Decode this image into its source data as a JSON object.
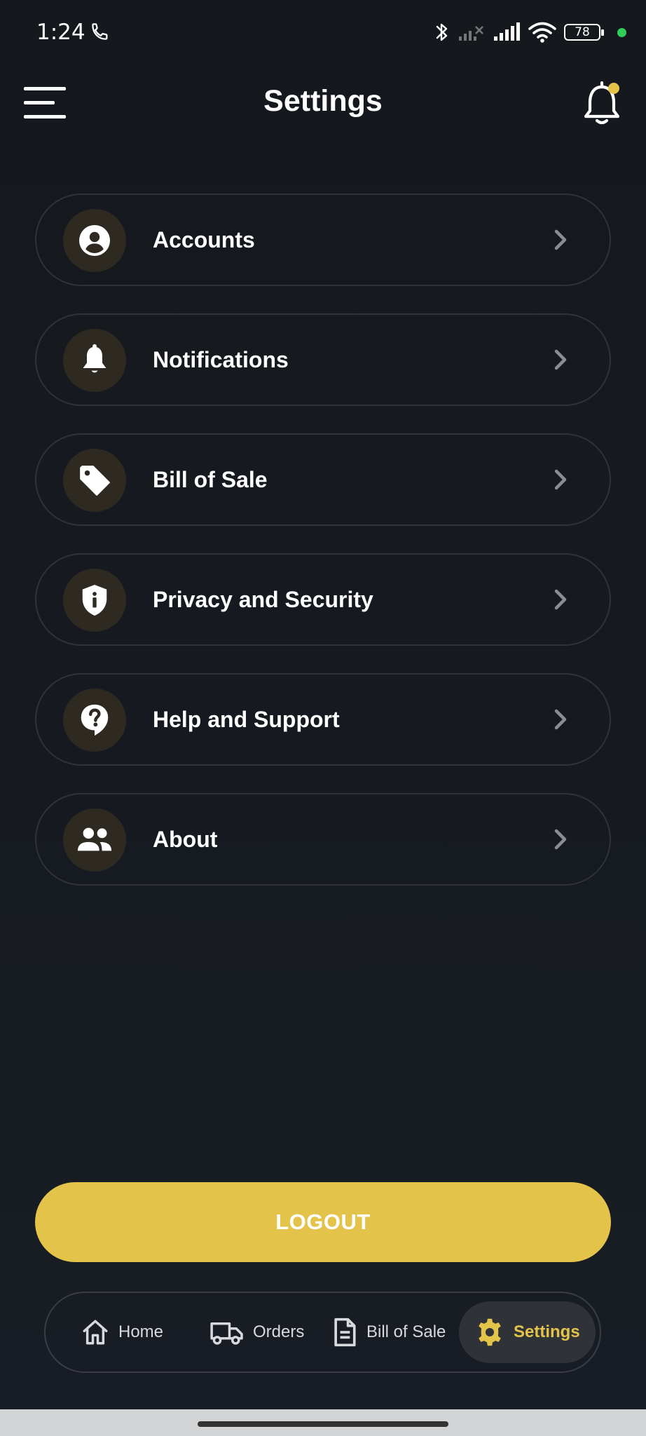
{
  "status_bar": {
    "time": "1:24",
    "battery": "78"
  },
  "header": {
    "title": "Settings"
  },
  "settings": {
    "items": [
      {
        "label": "Accounts",
        "icon": "account-circle-icon"
      },
      {
        "label": "Notifications",
        "icon": "bell-icon"
      },
      {
        "label": "Bill of Sale",
        "icon": "tag-icon"
      },
      {
        "label": "Privacy and Security",
        "icon": "shield-info-icon"
      },
      {
        "label": "Help and Support",
        "icon": "help-bubble-icon"
      },
      {
        "label": "About",
        "icon": "people-icon"
      }
    ]
  },
  "logout": {
    "label": "LOGOUT"
  },
  "bottom_nav": {
    "items": [
      {
        "label": "Home",
        "icon": "home-icon"
      },
      {
        "label": "Orders",
        "icon": "truck-icon"
      },
      {
        "label": "Bill of Sale",
        "icon": "document-icon"
      },
      {
        "label": "Settings",
        "icon": "gear-icon",
        "active": true
      }
    ]
  },
  "colors": {
    "accent": "#e3c34a",
    "background": "#16191e",
    "icon_circle": "#2e2a22",
    "status_dot": "#2fcd5a"
  }
}
